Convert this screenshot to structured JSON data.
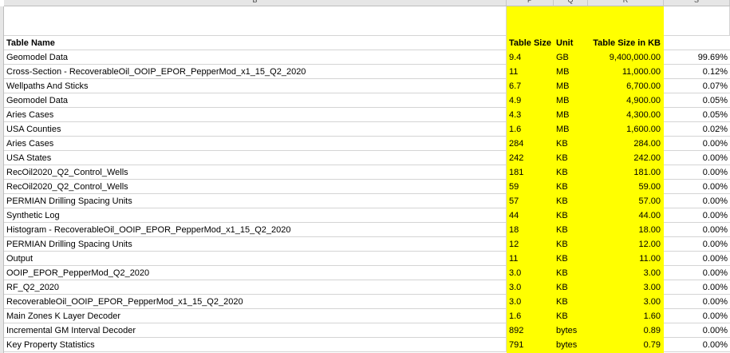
{
  "columns": {
    "b": "B",
    "p": "P",
    "q": "Q",
    "r": "R",
    "s": "S"
  },
  "headers": {
    "name": "Table Name",
    "size": "Table Size",
    "unit": "Unit",
    "kb": "Table Size in KB"
  },
  "highlight_color": "#ffff00",
  "rows": [
    {
      "name": "Geomodel Data",
      "size": "9.4",
      "unit": "GB",
      "kb": "9,400,000.00",
      "pct": "99.69%"
    },
    {
      "name": "Cross-Section - RecoverableOil_OOIP_EPOR_PepperMod_x1_15_Q2_2020",
      "size": "11",
      "unit": "MB",
      "kb": "11,000.00",
      "pct": "0.12%"
    },
    {
      "name": "Wellpaths And Sticks",
      "size": "6.7",
      "unit": "MB",
      "kb": "6,700.00",
      "pct": "0.07%"
    },
    {
      "name": "Geomodel Data",
      "size": "4.9",
      "unit": "MB",
      "kb": "4,900.00",
      "pct": "0.05%"
    },
    {
      "name": "Aries Cases",
      "size": "4.3",
      "unit": "MB",
      "kb": "4,300.00",
      "pct": "0.05%"
    },
    {
      "name": "USA Counties",
      "size": "1.6",
      "unit": "MB",
      "kb": "1,600.00",
      "pct": "0.02%"
    },
    {
      "name": "Aries Cases",
      "size": "284",
      "unit": "KB",
      "kb": "284.00",
      "pct": "0.00%"
    },
    {
      "name": "USA States",
      "size": "242",
      "unit": "KB",
      "kb": "242.00",
      "pct": "0.00%"
    },
    {
      "name": "RecOil2020_Q2_Control_Wells",
      "size": "181",
      "unit": "KB",
      "kb": "181.00",
      "pct": "0.00%"
    },
    {
      "name": "RecOil2020_Q2_Control_Wells",
      "size": "59",
      "unit": "KB",
      "kb": "59.00",
      "pct": "0.00%"
    },
    {
      "name": "PERMIAN Drilling Spacing Units",
      "size": "57",
      "unit": "KB",
      "kb": "57.00",
      "pct": "0.00%"
    },
    {
      "name": "Synthetic Log",
      "size": "44",
      "unit": "KB",
      "kb": "44.00",
      "pct": "0.00%"
    },
    {
      "name": "Histogram - RecoverableOil_OOIP_EPOR_PepperMod_x1_15_Q2_2020",
      "size": "18",
      "unit": "KB",
      "kb": "18.00",
      "pct": "0.00%"
    },
    {
      "name": "PERMIAN Drilling Spacing Units",
      "size": "12",
      "unit": "KB",
      "kb": "12.00",
      "pct": "0.00%"
    },
    {
      "name": "Output",
      "size": "11",
      "unit": "KB",
      "kb": "11.00",
      "pct": "0.00%"
    },
    {
      "name": "OOIP_EPOR_PepperMod_Q2_2020",
      "size": "3.0",
      "unit": "KB",
      "kb": "3.00",
      "pct": "0.00%"
    },
    {
      "name": "RF_Q2_2020",
      "size": "3.0",
      "unit": "KB",
      "kb": "3.00",
      "pct": "0.00%"
    },
    {
      "name": "RecoverableOil_OOIP_EPOR_PepperMod_x1_15_Q2_2020",
      "size": "3.0",
      "unit": "KB",
      "kb": "3.00",
      "pct": "0.00%"
    },
    {
      "name": "Main Zones K Layer Decoder",
      "size": "1.6",
      "unit": "KB",
      "kb": "1.60",
      "pct": "0.00%"
    },
    {
      "name": "Incremental GM Interval Decoder",
      "size": "892",
      "unit": "bytes",
      "kb": "0.89",
      "pct": "0.00%"
    },
    {
      "name": "Key Property Statistics",
      "size": "791",
      "unit": "bytes",
      "kb": "0.79",
      "pct": "0.00%"
    }
  ]
}
